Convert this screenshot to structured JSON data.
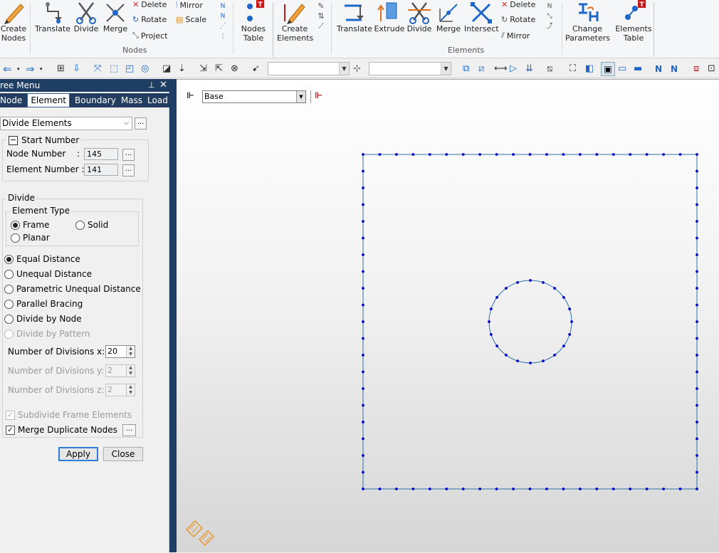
{
  "ribbon": {
    "nodes_group": {
      "label": "Nodes",
      "create_nodes": "Create\nNodes",
      "translate": "Translate",
      "divide": "Divide",
      "merge": "Merge",
      "delete": "Delete",
      "rotate": "Rotate",
      "project": "Project",
      "mirror": "Mirror",
      "scale": "Scale",
      "nodes_table": "Nodes\nTable"
    },
    "elements_group": {
      "label": "Elements",
      "create_elements": "Create\nElements",
      "translate": "Translate",
      "extrude": "Extrude",
      "divide": "Divide",
      "merge": "Merge",
      "intersect": "Intersect",
      "delete": "Delete",
      "rotate": "Rotate",
      "mirror": "Mirror",
      "change_parameters": "Change\nParameters",
      "elements_table": "Elements\nTable"
    }
  },
  "panel": {
    "title": "ree Menu",
    "tabs": [
      "Node",
      "Element",
      "Boundary",
      "Mass",
      "Load"
    ],
    "active_tab": "Element",
    "function_select": "Divide Elements",
    "start_number": {
      "title": "Start Number",
      "node_number_label": "Node Number",
      "node_number": "145",
      "element_number_label": "Element Number :",
      "element_number": "141",
      "colon": ":"
    },
    "divide": {
      "title": "Divide",
      "element_type_title": "Element Type",
      "types": {
        "frame": "Frame",
        "solid": "Solid",
        "planar": "Planar"
      },
      "methods": {
        "equal": "Equal Distance",
        "unequal": "Unequal Distance",
        "parametric": "Parametric Unequal Distance",
        "bracing": "Parallel Bracing",
        "by_node": "Divide by Node",
        "by_pattern": "Divide by Pattern"
      },
      "div_x_label": "Number of Divisions x:",
      "div_x": "20",
      "div_y_label": "Number of Divisions y:",
      "div_y": "2",
      "div_z_label": "Number of Divisions z:",
      "div_z": "2",
      "subdivide_label": "Subdivide Frame Elements",
      "merge_label": "Merge Duplicate Nodes"
    },
    "apply": "Apply",
    "close": "Close",
    "ellipsis": "..."
  },
  "view": {
    "plane_select": "Base",
    "node_color": "#0000cc",
    "line_color": "#2f6fa8"
  }
}
